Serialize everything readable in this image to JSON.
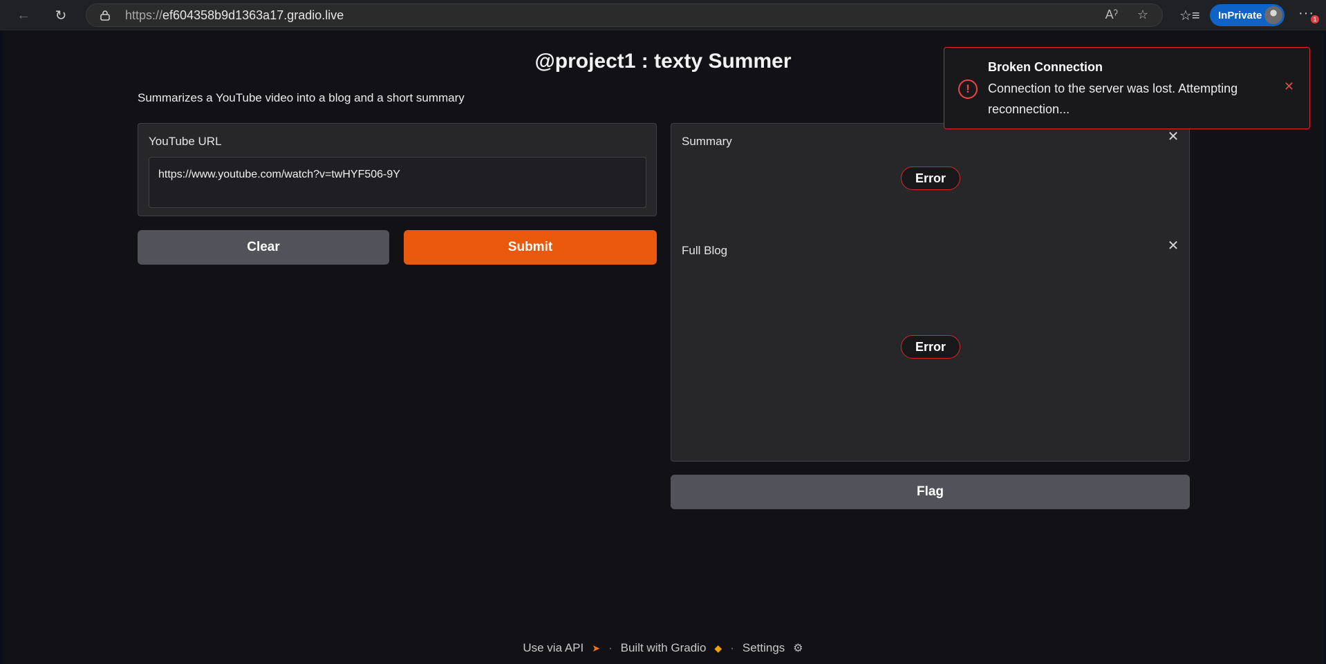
{
  "browser": {
    "url_scheme": "https://",
    "url_host": "ef604358b9d1363a17.gradio.live",
    "inprivate_label": "InPrivate",
    "notification_count": "1"
  },
  "app": {
    "title": "@project1 : texty Summer",
    "description": "Summarizes a YouTube video into a blog and a short summary"
  },
  "input": {
    "label": "YouTube URL",
    "value": "https://www.youtube.com/watch?v=twHYF506-9Y"
  },
  "buttons": {
    "clear": "Clear",
    "submit": "Submit",
    "flag": "Flag"
  },
  "outputs": {
    "summary_label": "Summary",
    "summary_status": "Error",
    "blog_label": "Full Blog",
    "blog_status": "Error"
  },
  "toast": {
    "title": "Broken Connection",
    "message": "Connection to the server was lost. Attempting reconnection...",
    "color": "#dc2626"
  },
  "footer": {
    "api_link": "Use via API",
    "built_with": "Built with Gradio",
    "settings": "Settings",
    "separator": "·"
  },
  "colors": {
    "accent": "#ea580c",
    "error": "#dc2626",
    "secondary_button": "#52525b"
  }
}
